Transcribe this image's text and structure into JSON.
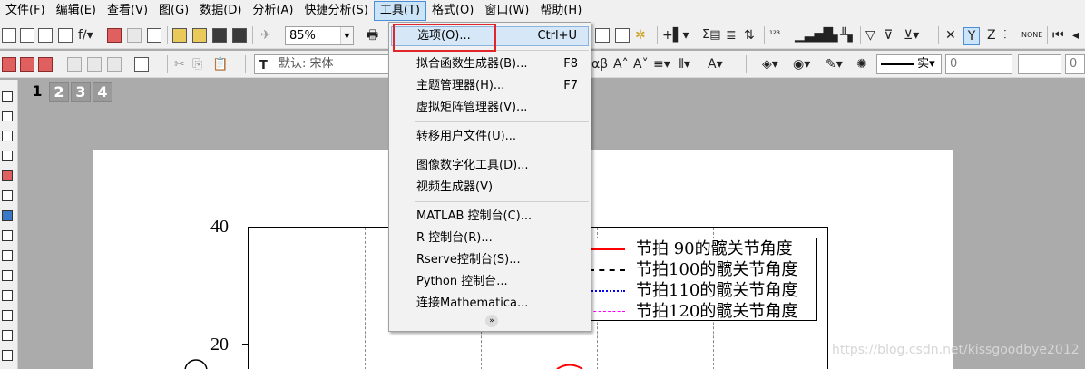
{
  "menubar": {
    "items": [
      {
        "label": "文件(F)"
      },
      {
        "label": "编辑(E)"
      },
      {
        "label": "查看(V)"
      },
      {
        "label": "图(G)"
      },
      {
        "label": "数据(D)"
      },
      {
        "label": "分析(A)"
      },
      {
        "label": "快捷分析(S)"
      },
      {
        "label": "工具(T)",
        "active": true
      },
      {
        "label": "格式(O)"
      },
      {
        "label": "窗口(W)"
      },
      {
        "label": "帮助(H)"
      }
    ]
  },
  "toolbar": {
    "zoom_value": "85%",
    "font_value": "默认: 宋体",
    "line_style": "实",
    "field_value_1": "0",
    "field_value_2": "0"
  },
  "page_tabs": [
    "1",
    "2",
    "3",
    "4"
  ],
  "tools_menu": {
    "items": [
      {
        "label": "选项(O)...",
        "shortcut": "Ctrl+U",
        "highlighted": true
      },
      {
        "label": "拟合函数生成器(B)...",
        "shortcut": "F8"
      },
      {
        "label": "主题管理器(H)...",
        "shortcut": "F7"
      },
      {
        "label": "虚拟矩阵管理器(V)...",
        "shortcut": ""
      },
      {
        "label": "转移用户文件(U)...",
        "shortcut": ""
      },
      {
        "label": "图像数字化工具(D)...",
        "shortcut": ""
      },
      {
        "label": "视频生成器(V)",
        "shortcut": ""
      },
      {
        "label": "MATLAB 控制台(C)...",
        "shortcut": ""
      },
      {
        "label": "R 控制台(R)...",
        "shortcut": ""
      },
      {
        "label": "Rserve控制台(S)...",
        "shortcut": ""
      },
      {
        "label": "Python 控制台...",
        "shortcut": ""
      },
      {
        "label": "连接Mathematica...",
        "shortcut": ""
      }
    ],
    "more_glyph": "»"
  },
  "graph": {
    "y_ticks": [
      "40",
      "20"
    ],
    "legend": [
      {
        "label": "节拍  90的髋关节角度",
        "color": "#ff0000",
        "style": "solid"
      },
      {
        "label": "节拍100的髋关节角度",
        "color": "#000000",
        "style": "dashed"
      },
      {
        "label": "节拍110的髋关节角度",
        "color": "#0000ff",
        "style": "dotted"
      },
      {
        "label": "节拍120的髋关节角度",
        "color": "#ff00ff",
        "style": "dashdot"
      }
    ]
  },
  "watermark": "https://blog.csdn.net/kissgoodbye2012",
  "colors": {
    "highlight_box": "#e0262b",
    "menu_highlight": "#d6e8f8"
  }
}
